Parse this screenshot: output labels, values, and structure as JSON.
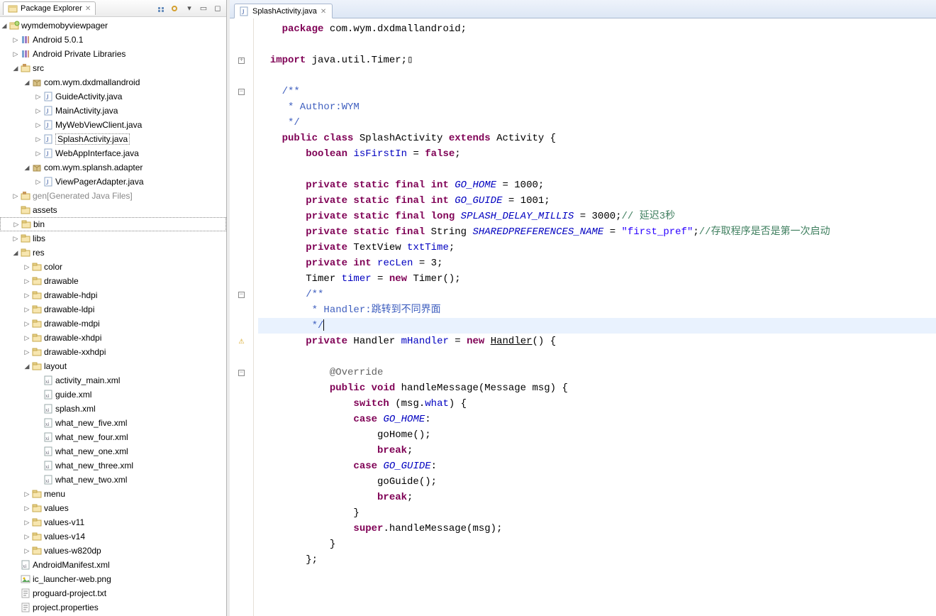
{
  "explorer": {
    "title": "Package Explorer",
    "tree": [
      {
        "d": 0,
        "ex": "open",
        "icon": "project",
        "label": "wymdemobyviewpager"
      },
      {
        "d": 1,
        "ex": "closed",
        "icon": "library",
        "label": "Android 5.0.1"
      },
      {
        "d": 1,
        "ex": "closed",
        "icon": "library",
        "label": "Android Private Libraries"
      },
      {
        "d": 1,
        "ex": "open",
        "icon": "srcfolder",
        "label": "src"
      },
      {
        "d": 2,
        "ex": "open",
        "icon": "package",
        "label": "com.wym.dxdmallandroid"
      },
      {
        "d": 3,
        "ex": "closed",
        "icon": "javafile",
        "label": "GuideActivity.java"
      },
      {
        "d": 3,
        "ex": "closed",
        "icon": "javafile",
        "label": "MainActivity.java"
      },
      {
        "d": 3,
        "ex": "closed",
        "icon": "javafile",
        "label": "MyWebViewClient.java"
      },
      {
        "d": 3,
        "ex": "closed",
        "icon": "javafile",
        "label": "SplashActivity.java",
        "selected": true
      },
      {
        "d": 3,
        "ex": "closed",
        "icon": "javafile",
        "label": "WebAppInterface.java"
      },
      {
        "d": 2,
        "ex": "open",
        "icon": "package",
        "label": "com.wym.splansh.adapter"
      },
      {
        "d": 3,
        "ex": "closed",
        "icon": "javafile",
        "label": "ViewPagerAdapter.java"
      },
      {
        "d": 1,
        "ex": "closed",
        "icon": "srcfolder",
        "label": "gen",
        "suffix": "[Generated Java Files]",
        "gen": true
      },
      {
        "d": 1,
        "ex": "none",
        "icon": "folder",
        "label": "assets"
      },
      {
        "d": 1,
        "ex": "closed",
        "icon": "folder",
        "label": "bin",
        "selected_border": true
      },
      {
        "d": 1,
        "ex": "closed",
        "icon": "folder",
        "label": "libs"
      },
      {
        "d": 1,
        "ex": "open",
        "icon": "folder",
        "label": "res"
      },
      {
        "d": 2,
        "ex": "closed",
        "icon": "folder",
        "label": "color"
      },
      {
        "d": 2,
        "ex": "closed",
        "icon": "folder",
        "label": "drawable"
      },
      {
        "d": 2,
        "ex": "closed",
        "icon": "folder",
        "label": "drawable-hdpi"
      },
      {
        "d": 2,
        "ex": "closed",
        "icon": "folder",
        "label": "drawable-ldpi"
      },
      {
        "d": 2,
        "ex": "closed",
        "icon": "folder",
        "label": "drawable-mdpi"
      },
      {
        "d": 2,
        "ex": "closed",
        "icon": "folder",
        "label": "drawable-xhdpi"
      },
      {
        "d": 2,
        "ex": "closed",
        "icon": "folder",
        "label": "drawable-xxhdpi"
      },
      {
        "d": 2,
        "ex": "open",
        "icon": "folder",
        "label": "layout"
      },
      {
        "d": 3,
        "ex": "none",
        "icon": "xmlfile",
        "label": "activity_main.xml"
      },
      {
        "d": 3,
        "ex": "none",
        "icon": "xmlfile",
        "label": "guide.xml"
      },
      {
        "d": 3,
        "ex": "none",
        "icon": "xmlfile",
        "label": "splash.xml"
      },
      {
        "d": 3,
        "ex": "none",
        "icon": "xmlfile",
        "label": "what_new_five.xml"
      },
      {
        "d": 3,
        "ex": "none",
        "icon": "xmlfile",
        "label": "what_new_four.xml"
      },
      {
        "d": 3,
        "ex": "none",
        "icon": "xmlfile",
        "label": "what_new_one.xml"
      },
      {
        "d": 3,
        "ex": "none",
        "icon": "xmlfile",
        "label": "what_new_three.xml"
      },
      {
        "d": 3,
        "ex": "none",
        "icon": "xmlfile",
        "label": "what_new_two.xml"
      },
      {
        "d": 2,
        "ex": "closed",
        "icon": "folder",
        "label": "menu"
      },
      {
        "d": 2,
        "ex": "closed",
        "icon": "folder",
        "label": "values"
      },
      {
        "d": 2,
        "ex": "closed",
        "icon": "folder",
        "label": "values-v11"
      },
      {
        "d": 2,
        "ex": "closed",
        "icon": "folder",
        "label": "values-v14"
      },
      {
        "d": 2,
        "ex": "closed",
        "icon": "folder",
        "label": "values-w820dp"
      },
      {
        "d": 1,
        "ex": "none",
        "icon": "xmlfile",
        "label": "AndroidManifest.xml"
      },
      {
        "d": 1,
        "ex": "none",
        "icon": "imgfile",
        "label": "ic_launcher-web.png"
      },
      {
        "d": 1,
        "ex": "none",
        "icon": "txtfile",
        "label": "proguard-project.txt"
      },
      {
        "d": 1,
        "ex": "none",
        "icon": "txtfile",
        "label": "project.properties"
      }
    ]
  },
  "editor": {
    "tab_label": "SplashActivity.java",
    "lines": [
      {
        "g": "",
        "spans": [
          {
            "t": "    "
          },
          {
            "t": "package",
            "c": "kw"
          },
          {
            "t": " com.wym.dxdmallandroid;"
          }
        ]
      },
      {
        "g": "",
        "spans": [
          {
            "t": " "
          }
        ]
      },
      {
        "g": "plus",
        "spans": [
          {
            "t": "  "
          },
          {
            "t": "import",
            "c": "kw"
          },
          {
            "t": " java.util.Timer;"
          },
          {
            "t": "▯"
          }
        ]
      },
      {
        "g": "",
        "spans": [
          {
            "t": " "
          }
        ]
      },
      {
        "g": "minus",
        "spans": [
          {
            "t": "    "
          },
          {
            "t": "/**",
            "c": "jdoc"
          }
        ]
      },
      {
        "g": "",
        "spans": [
          {
            "t": "     * Author:WYM",
            "c": "jdoc"
          }
        ]
      },
      {
        "g": "",
        "spans": [
          {
            "t": "     */",
            "c": "jdoc"
          }
        ]
      },
      {
        "g": "",
        "spans": [
          {
            "t": "    "
          },
          {
            "t": "public class",
            "c": "kw"
          },
          {
            "t": " SplashActivity "
          },
          {
            "t": "extends",
            "c": "kw"
          },
          {
            "t": " Activity {"
          }
        ]
      },
      {
        "g": "",
        "spans": [
          {
            "t": "        "
          },
          {
            "t": "boolean",
            "c": "kw"
          },
          {
            "t": " "
          },
          {
            "t": "isFirstIn",
            "c": "fld"
          },
          {
            "t": " = "
          },
          {
            "t": "false",
            "c": "kw"
          },
          {
            "t": ";"
          }
        ]
      },
      {
        "g": "",
        "spans": [
          {
            "t": " "
          }
        ]
      },
      {
        "g": "",
        "spans": [
          {
            "t": "        "
          },
          {
            "t": "private static final int",
            "c": "kw"
          },
          {
            "t": " "
          },
          {
            "t": "GO_HOME",
            "c": "sta"
          },
          {
            "t": " = 1000;"
          }
        ]
      },
      {
        "g": "",
        "spans": [
          {
            "t": "        "
          },
          {
            "t": "private static final int",
            "c": "kw"
          },
          {
            "t": " "
          },
          {
            "t": "GO_GUIDE",
            "c": "sta"
          },
          {
            "t": " = 1001;"
          }
        ]
      },
      {
        "g": "",
        "spans": [
          {
            "t": "        "
          },
          {
            "t": "private static final long",
            "c": "kw"
          },
          {
            "t": " "
          },
          {
            "t": "SPLASH_DELAY_MILLIS",
            "c": "sta"
          },
          {
            "t": " = 3000;"
          },
          {
            "t": "// 延迟3秒",
            "c": "cmnt"
          }
        ]
      },
      {
        "g": "",
        "spans": [
          {
            "t": "        "
          },
          {
            "t": "private static final",
            "c": "kw"
          },
          {
            "t": " String "
          },
          {
            "t": "SHAREDPREFERENCES_NAME",
            "c": "sta"
          },
          {
            "t": " = "
          },
          {
            "t": "\"first_pref\"",
            "c": "str"
          },
          {
            "t": ";"
          },
          {
            "t": "//存取程序是否是第一次启动",
            "c": "cmnt"
          }
        ]
      },
      {
        "g": "",
        "spans": [
          {
            "t": "        "
          },
          {
            "t": "private",
            "c": "kw"
          },
          {
            "t": " TextView "
          },
          {
            "t": "txtTime",
            "c": "fld"
          },
          {
            "t": ";"
          }
        ]
      },
      {
        "g": "",
        "spans": [
          {
            "t": "        "
          },
          {
            "t": "private int",
            "c": "kw"
          },
          {
            "t": " "
          },
          {
            "t": "recLen",
            "c": "fld"
          },
          {
            "t": " = 3;"
          }
        ]
      },
      {
        "g": "",
        "spans": [
          {
            "t": "        Timer "
          },
          {
            "t": "timer",
            "c": "fld"
          },
          {
            "t": " = "
          },
          {
            "t": "new",
            "c": "kw"
          },
          {
            "t": " Timer();"
          }
        ]
      },
      {
        "g": "minus",
        "spans": [
          {
            "t": "        "
          },
          {
            "t": "/**",
            "c": "jdoc"
          }
        ]
      },
      {
        "g": "",
        "spans": [
          {
            "t": "         * Handler:跳转到不同界面",
            "c": "jdoc"
          }
        ]
      },
      {
        "g": "",
        "hl": true,
        "spans": [
          {
            "t": "         */",
            "c": "jdoc"
          },
          {
            "caret": true
          }
        ]
      },
      {
        "g": "warn-minus",
        "spans": [
          {
            "t": "        "
          },
          {
            "t": "private",
            "c": "kw"
          },
          {
            "t": " Handler "
          },
          {
            "t": "mHandler",
            "c": "fld"
          },
          {
            "t": " = "
          },
          {
            "t": "new",
            "c": "kw"
          },
          {
            "t": " "
          },
          {
            "t": "Handler",
            "u": true
          },
          {
            "t": "() {"
          }
        ]
      },
      {
        "g": "",
        "spans": [
          {
            "t": " "
          }
        ]
      },
      {
        "g": "minus",
        "spans": [
          {
            "t": "            "
          },
          {
            "t": "@Override",
            "c": "ann"
          }
        ]
      },
      {
        "g": "",
        "spans": [
          {
            "t": "            "
          },
          {
            "t": "public void",
            "c": "kw"
          },
          {
            "t": " handleMessage(Message msg) {"
          }
        ]
      },
      {
        "g": "",
        "spans": [
          {
            "t": "                "
          },
          {
            "t": "switch",
            "c": "kw"
          },
          {
            "t": " (msg."
          },
          {
            "t": "what",
            "c": "fld"
          },
          {
            "t": ") {"
          }
        ]
      },
      {
        "g": "",
        "spans": [
          {
            "t": "                "
          },
          {
            "t": "case",
            "c": "kw"
          },
          {
            "t": " "
          },
          {
            "t": "GO_HOME",
            "c": "sta"
          },
          {
            "t": ":"
          }
        ]
      },
      {
        "g": "",
        "spans": [
          {
            "t": "                    goHome();"
          }
        ]
      },
      {
        "g": "",
        "spans": [
          {
            "t": "                    "
          },
          {
            "t": "break",
            "c": "kw"
          },
          {
            "t": ";"
          }
        ]
      },
      {
        "g": "",
        "spans": [
          {
            "t": "                "
          },
          {
            "t": "case",
            "c": "kw"
          },
          {
            "t": " "
          },
          {
            "t": "GO_GUIDE",
            "c": "sta"
          },
          {
            "t": ":"
          }
        ]
      },
      {
        "g": "",
        "spans": [
          {
            "t": "                    goGuide();"
          }
        ]
      },
      {
        "g": "",
        "spans": [
          {
            "t": "                    "
          },
          {
            "t": "break",
            "c": "kw"
          },
          {
            "t": ";"
          }
        ]
      },
      {
        "g": "",
        "spans": [
          {
            "t": "                }"
          }
        ]
      },
      {
        "g": "",
        "spans": [
          {
            "t": "                "
          },
          {
            "t": "super",
            "c": "kw"
          },
          {
            "t": ".handleMessage(msg);"
          }
        ]
      },
      {
        "g": "",
        "spans": [
          {
            "t": "            }"
          }
        ]
      },
      {
        "g": "",
        "spans": [
          {
            "t": "        };"
          }
        ]
      },
      {
        "g": "",
        "spans": [
          {
            "t": " "
          }
        ]
      }
    ]
  }
}
